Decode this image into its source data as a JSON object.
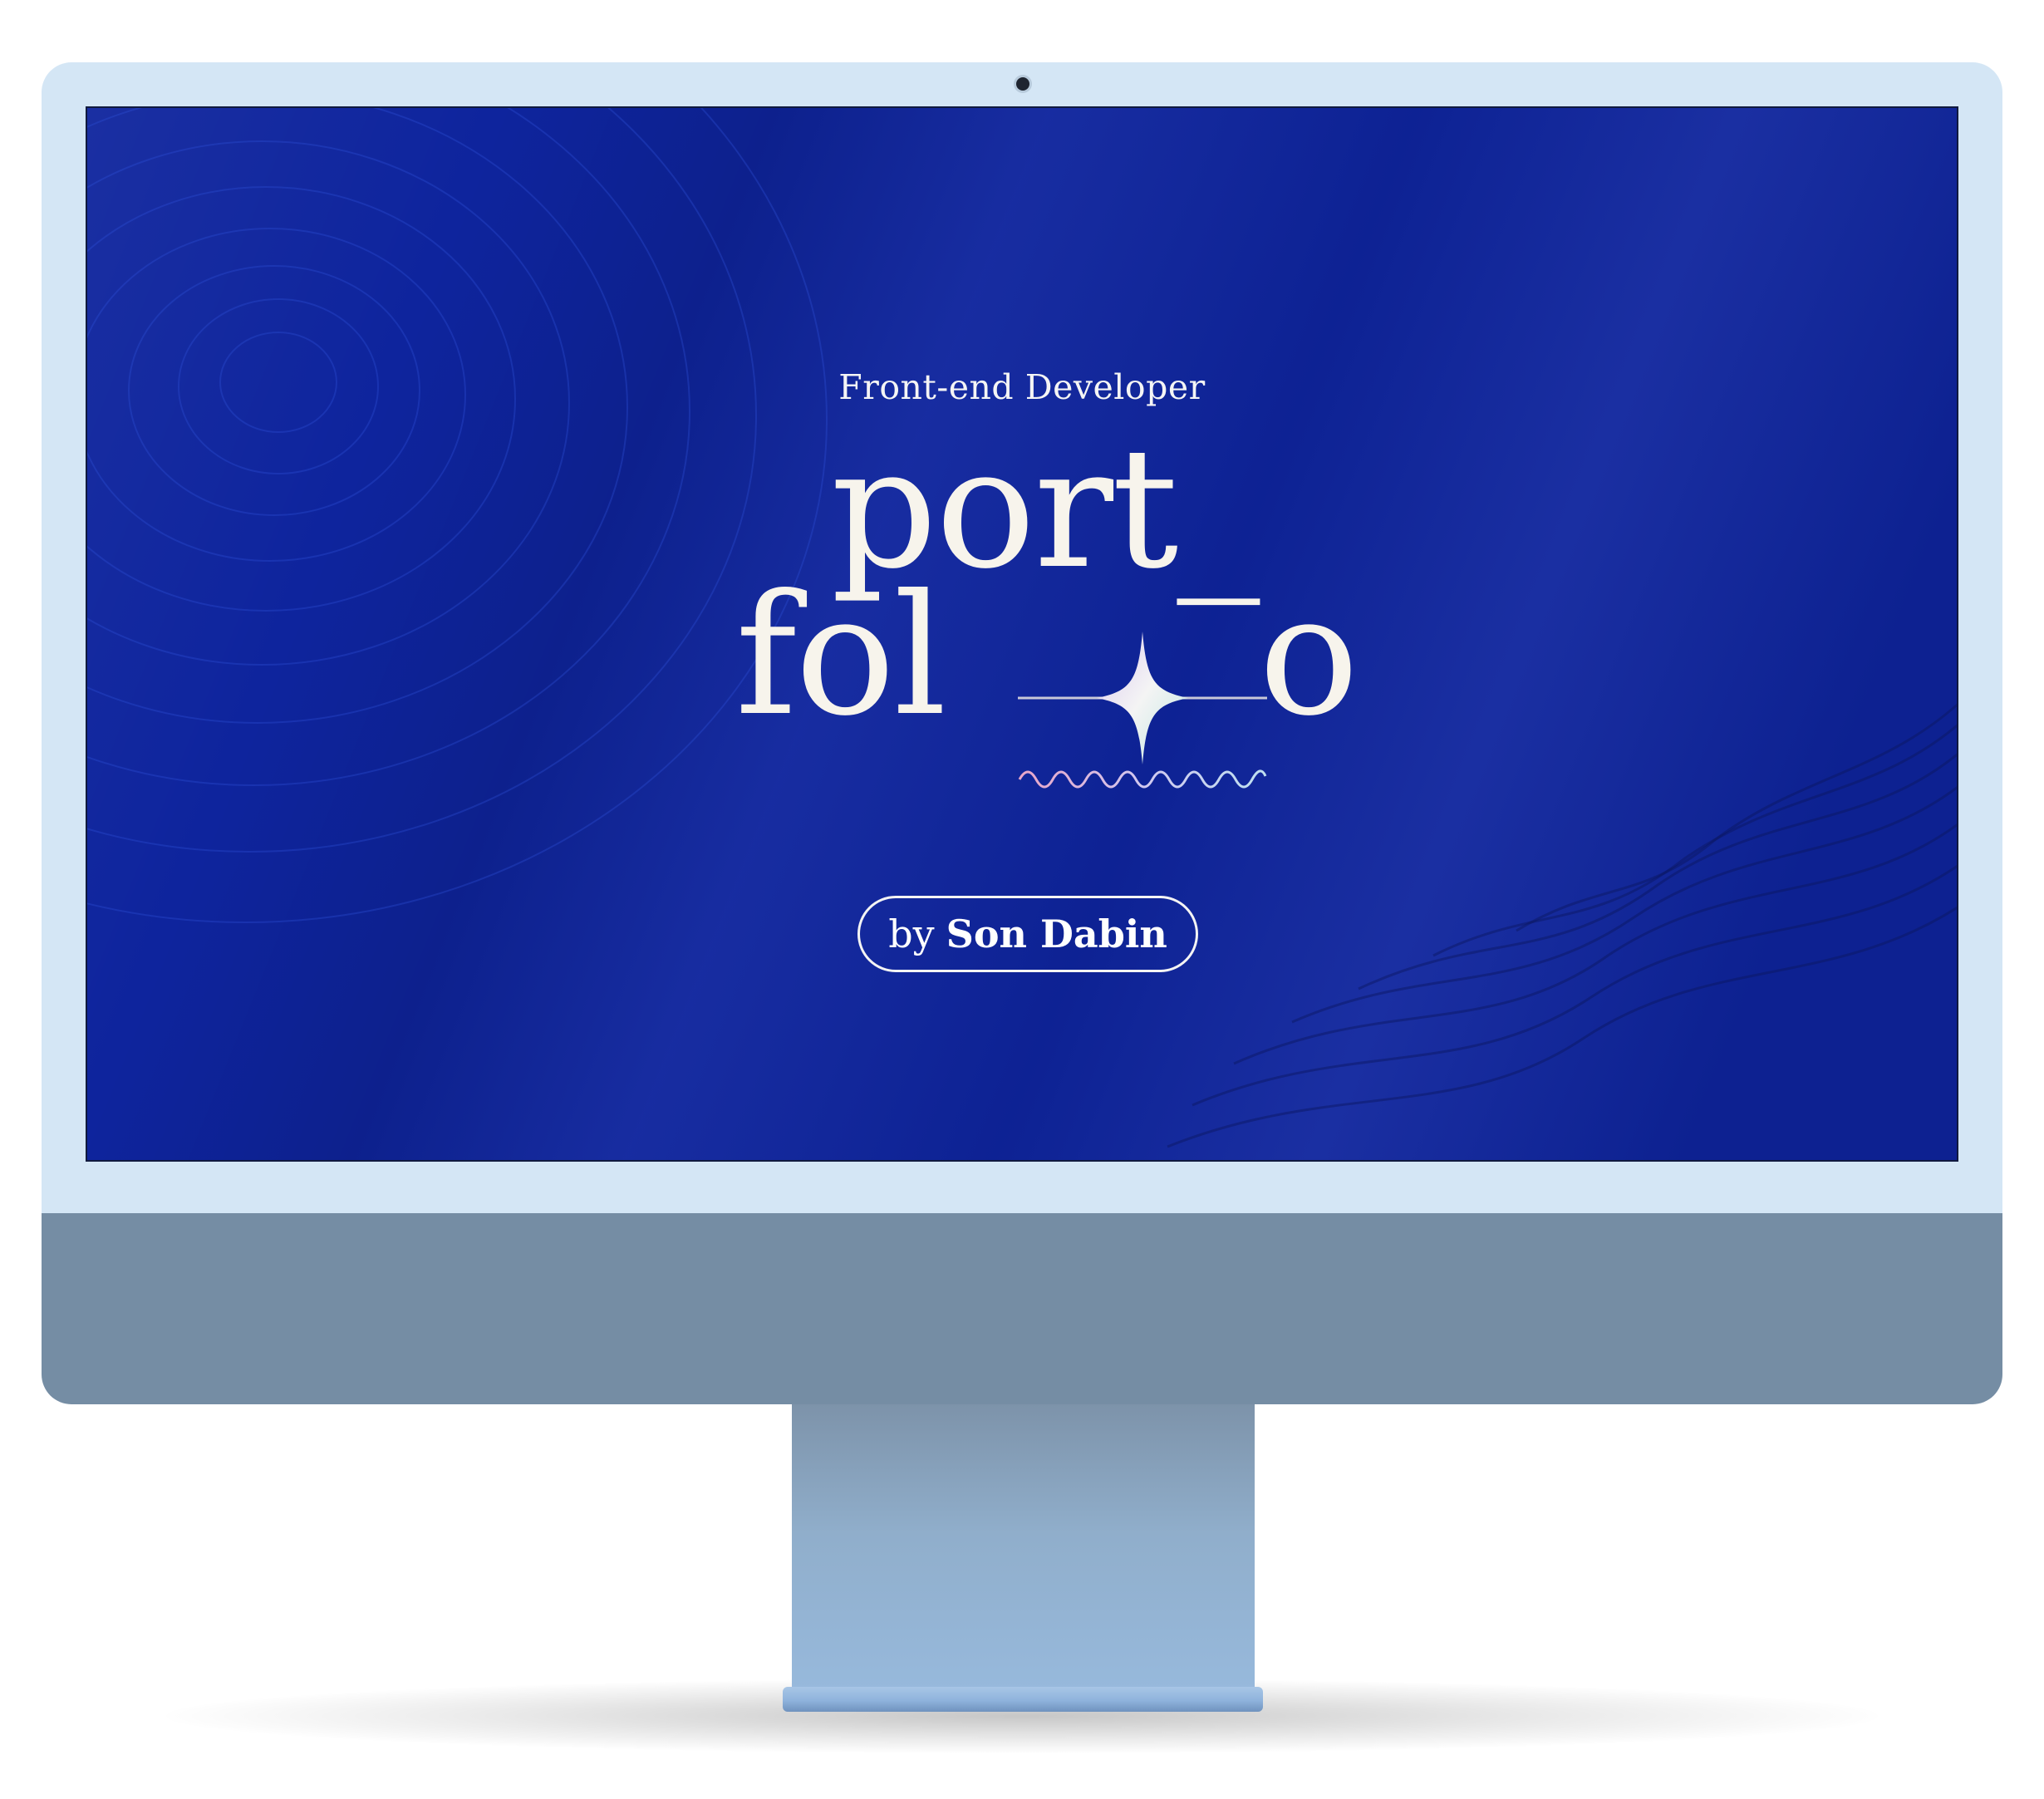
{
  "screen": {
    "subtitle": "Front-end Developer",
    "title_line_1": "port_",
    "title_line_2_start": "fol",
    "title_line_2_end": "o",
    "byline_prefix": "by",
    "byline_name": "Son Dabin"
  },
  "colors": {
    "screen_background": "#0e249d",
    "bezel": "#d4e6f5",
    "chin": "#758da4",
    "text": "#f7f4ec"
  },
  "icons": {
    "sparkle": "four-point-star-icon",
    "wave": "wavy-line-icon",
    "camera": "camera-icon"
  }
}
